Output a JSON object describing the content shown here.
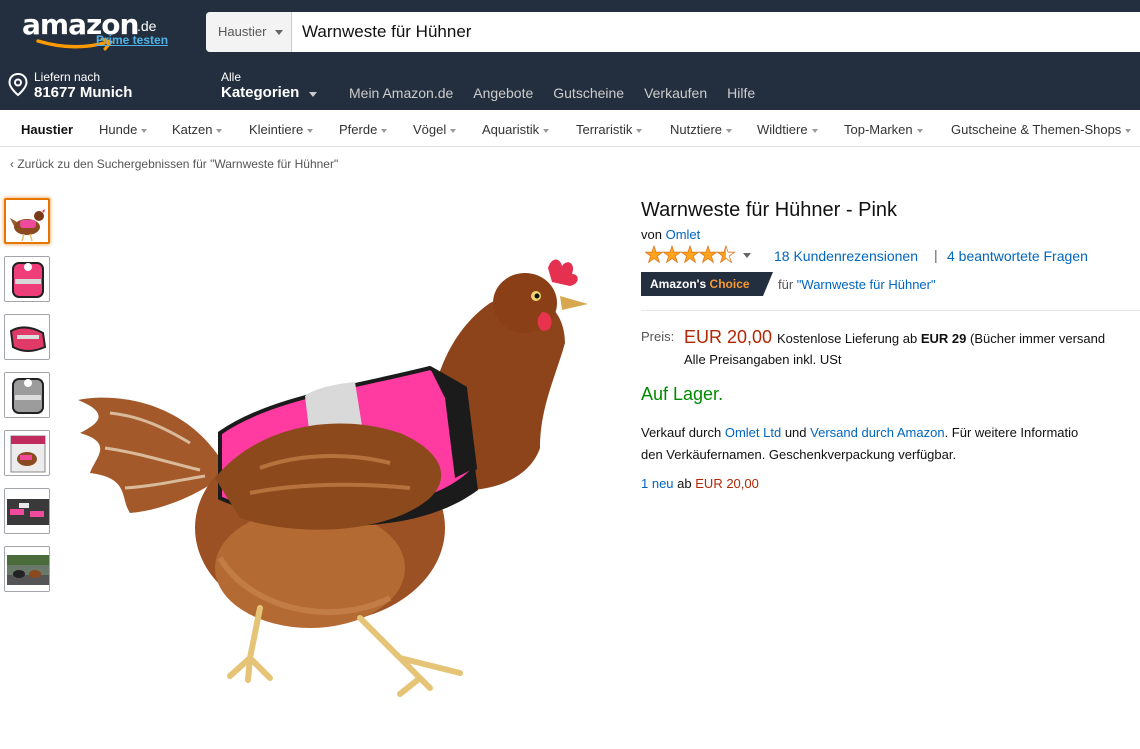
{
  "header": {
    "logo_text": "amazon",
    "logo_tld": ".de",
    "prime_link": "Prime testen",
    "search_category": "Haustier",
    "search_value": "Warnweste für Hühner",
    "deliver_line1": "Liefern nach",
    "deliver_line2": "81677 Munich",
    "all_line1": "Alle",
    "all_line2": "Kategorien",
    "nav_links": [
      "Mein Amazon.de",
      "Angebote",
      "Gutscheine",
      "Verkaufen",
      "Hilfe"
    ]
  },
  "categories": [
    "Haustier",
    "Hunde",
    "Katzen",
    "Kleintiere",
    "Pferde",
    "Vögel",
    "Aquaristik",
    "Terraristik",
    "Nutztiere",
    "Wildtiere",
    "Top-Marken",
    "Gutscheine & Themen-Shops"
  ],
  "breadcrumb": "‹ Zurück zu den Suchergebnissen für \"Warnweste für Hühner\"",
  "gallery": {
    "thumbnails": [
      "hen-in-pink-vest",
      "pink-vest-front",
      "pink-vest-side",
      "grey-vest-front",
      "hen-in-vest-box",
      "hens-in-vests-group",
      "hens-on-road"
    ],
    "selected_index": 0
  },
  "product": {
    "title": "Warnweste für Hühner - Pink",
    "by_prefix": "von",
    "brand": "Omlet",
    "rating": 4.5,
    "rating_max": 5,
    "reviews": "18 Kundenrezensionen",
    "separator": "|",
    "answers": "4 beantwortete Fragen",
    "badge_a": "Amazon's",
    "badge_b": "Choice",
    "badge_for_prefix": "für",
    "badge_keyword": "\"Warnweste für Hühner\"",
    "price_label": "Preis:",
    "price": "EUR 20,00",
    "shipping_a": "Kostenlose Lieferung ab",
    "shipping_b": "EUR 29",
    "shipping_c": "(Bücher immer versand",
    "tax_note": "Alle Preisangaben inkl. USt",
    "stock": "Auf Lager.",
    "seller_a": "Verkauf durch",
    "seller_name": "Omlet Ltd",
    "seller_b": "und",
    "seller_link": "Versand durch Amazon",
    "seller_c": ". Für weitere Informatio",
    "seller_line2": "den Verkäufernamen. Geschenkverpackung verfügbar.",
    "offers_link": "1 neu",
    "offers_mid": "ab",
    "offers_price": "EUR 20,00"
  },
  "colors": {
    "header_bg": "#232f3e",
    "link": "#0066c0",
    "price": "#b12704",
    "in_stock": "#008a00",
    "badge_orange": "#f69931",
    "selection": "#e77600"
  }
}
